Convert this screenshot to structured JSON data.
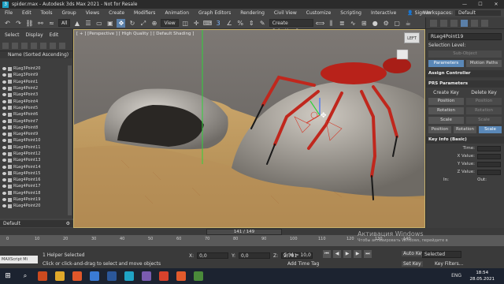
{
  "window": {
    "title": "spider.max - Autodesk 3ds Max 2021 - Not for Resale",
    "controls": [
      "—",
      "☐",
      "✕"
    ]
  },
  "menu": {
    "items": [
      "File",
      "Edit",
      "Tools",
      "Group",
      "Views",
      "Create",
      "Modifiers",
      "Animation",
      "Graph Editors",
      "Rendering",
      "Civil View",
      "Customize",
      "Scripting",
      "Interactive"
    ],
    "signin": "Sign In",
    "workspaces_label": "Workspaces:",
    "workspaces_value": "Default"
  },
  "toolbar": {
    "filter_value": "All",
    "view_value": "View",
    "selection_set_placeholder": "Create Selection Se"
  },
  "left_panel": {
    "tabs": [
      "Select",
      "Display",
      "Edit"
    ],
    "header": "Name (Sorted Ascending)",
    "items": [
      "RLeg3Point20",
      "RLeg3Point9",
      "RLeg4Point1",
      "RLeg4Point2",
      "RLeg4Point3",
      "RLeg4Point4",
      "RLeg4Point5",
      "RLeg4Point6",
      "RLeg4Point7",
      "RLeg4Point8",
      "RLeg4Point9",
      "RLeg4Point10",
      "RLeg4Point11",
      "RLeg4Point12",
      "RLeg4Point13",
      "RLeg4Point14",
      "RLeg4Point15",
      "RLeg4Point16",
      "RLeg4Point17",
      "RLeg4Point18",
      "RLeg4Point19",
      "RLeg4Point20"
    ],
    "layer": "Default"
  },
  "viewport": {
    "label": "[ + ] [Perspective ] [ High Quality ] [ Default Shading ]",
    "viewcube": "LEFT"
  },
  "command_panel": {
    "object_name": "RLeg4Point19",
    "selection_level_label": "Selection Level:",
    "sub_object_label": "Sub-Object",
    "parameters_label": "Parameters",
    "motion_paths_label": "Motion Paths",
    "assign_controller_label": "Assign Controller",
    "prs_label": "PRS Parameters",
    "create_key_label": "Create Key",
    "delete_key_label": "Delete Key",
    "position_label": "Position",
    "rotation_label": "Rotation",
    "scale_label": "Scale",
    "key_info_label": "Key Info (Basic)",
    "time_label": "Time:",
    "x_value_label": "X Value:",
    "y_value_label": "Y Value:",
    "z_value_label": "Z Value:",
    "in_label": "In:",
    "out_label": "Out:"
  },
  "timeline": {
    "frame_display": "141 / 149",
    "ticks": [
      "0",
      "10",
      "20",
      "30",
      "40",
      "50",
      "60",
      "70",
      "80",
      "90",
      "100",
      "110",
      "120",
      "130",
      "140"
    ]
  },
  "status": {
    "maxscript": "MAXScript Mi",
    "line1": "1 Helper Selected",
    "line2": "Click or click-and-drag to select and move objects",
    "x": "0,0",
    "y": "0,0",
    "z": "2,791",
    "grid": "Grid = 10,0",
    "add_time_tag": "Add Time Tag",
    "auto_key": "Auto Key",
    "selected": "Selected",
    "set_key": "Set Key",
    "key_filters": "Key Filters..."
  },
  "watermark": {
    "title": "Активация Windows",
    "subtitle": "Чтобы активировать Windows, перейдите в"
  },
  "taskbar": {
    "time": "18:54",
    "date": "28.05.2021",
    "lang": "ENG"
  }
}
